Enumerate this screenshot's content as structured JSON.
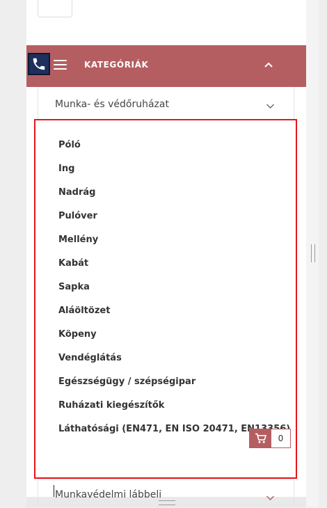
{
  "header": {
    "title": "KATEGÓRIÁK",
    "accent_color": "#b55e61",
    "phone_icon": "phone-icon",
    "menu_icon": "hamburger-icon",
    "collapse_icon": "chevron-up-icon"
  },
  "groups": [
    {
      "label": "Munka- és védőruházat",
      "expanded": true
    },
    {
      "label": "Munkavédelmi lábbeli",
      "expanded": false
    }
  ],
  "subcategories": [
    "Póló",
    "Ing",
    "Nadrág",
    "Pulóver",
    "Mellény",
    "Kabát",
    "Sapka",
    "Aláöltözet",
    "Köpeny",
    "Vendéglátás",
    "Egészségügy / szépségipar",
    "Ruházati kiegészítők",
    "Láthatósági (EN471, EN ISO 20471, EN13356)"
  ],
  "cart": {
    "count": "0",
    "icon": "cart-icon"
  },
  "highlight_color": "#e8141a"
}
